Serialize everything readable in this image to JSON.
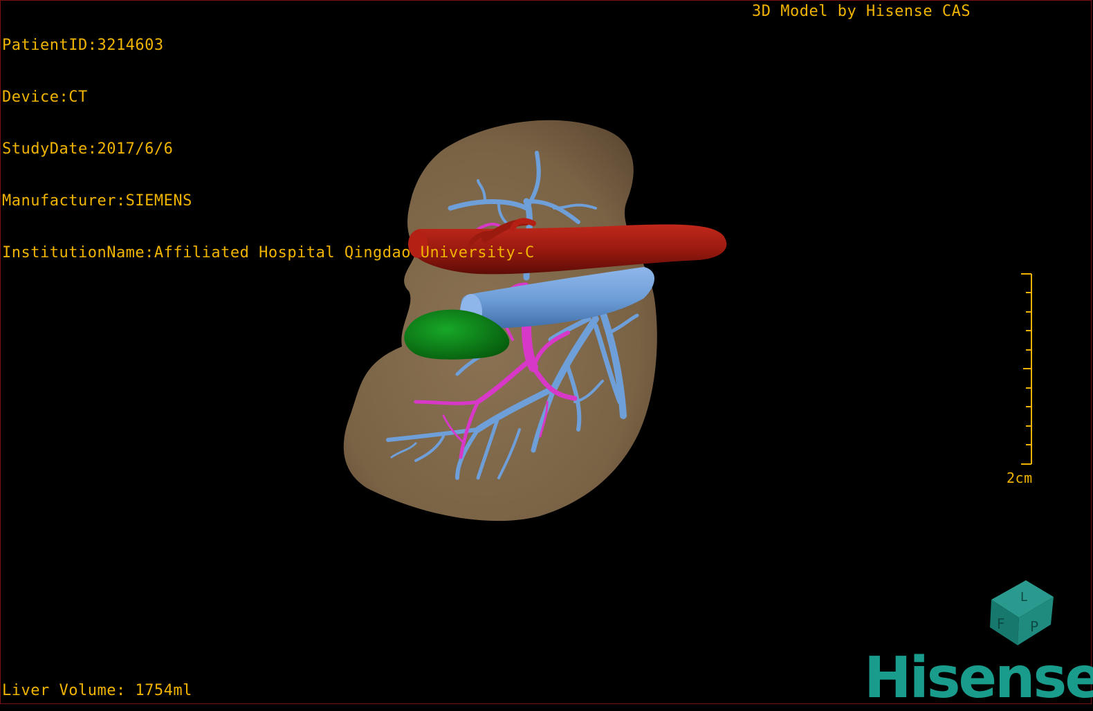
{
  "overlay": {
    "patient_id": "PatientID:3214603",
    "device": "Device:CT",
    "study_date": "StudyDate:2017/6/6",
    "manufacturer": "Manufacturer:SIEMENS",
    "institution": "InstitutionName:Affiliated Hospital Qingdao University-C",
    "credit": "3D Model by Hisense CAS",
    "liver_volume": "Liver Volume: 1754ml"
  },
  "scale_bar": {
    "label": "2cm"
  },
  "orientation_cube": {
    "faces": [
      "F",
      "L",
      "P"
    ]
  },
  "brand": {
    "logo_text": "Hisense",
    "color": "#1a9c8c"
  },
  "colors": {
    "text": "#f0b400",
    "liver": "#7d6648",
    "artery": "#9a1a10",
    "portal_vein": "#6f9fd8",
    "hepatic_vein": "#d838c8",
    "gallbladder": "#0c8a18",
    "background": "#000000"
  }
}
